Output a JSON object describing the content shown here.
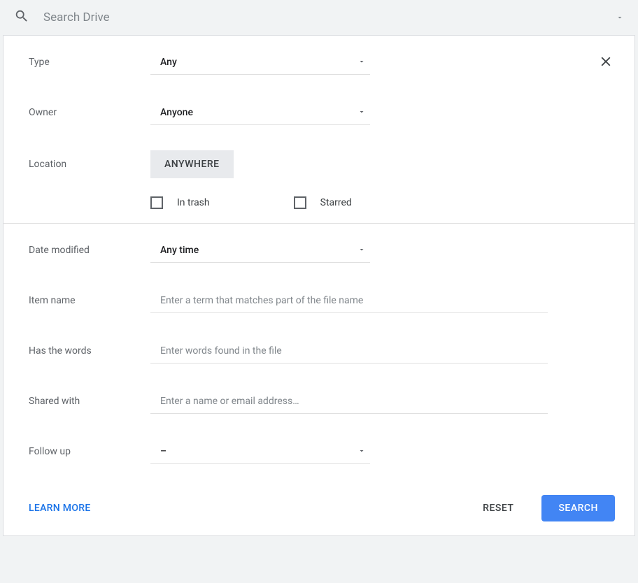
{
  "search": {
    "placeholder": "Search Drive"
  },
  "filters": {
    "type": {
      "label": "Type",
      "value": "Any"
    },
    "owner": {
      "label": "Owner",
      "value": "Anyone"
    },
    "location": {
      "label": "Location",
      "value": "ANYWHERE"
    },
    "in_trash": {
      "label": "In trash"
    },
    "starred": {
      "label": "Starred"
    },
    "date_modified": {
      "label": "Date modified",
      "value": "Any time"
    },
    "item_name": {
      "label": "Item name",
      "placeholder": "Enter a term that matches part of the file name"
    },
    "has_words": {
      "label": "Has the words",
      "placeholder": "Enter words found in the file"
    },
    "shared_with": {
      "label": "Shared with",
      "placeholder": "Enter a name or email address…"
    },
    "follow_up": {
      "label": "Follow up",
      "value": "–"
    }
  },
  "footer": {
    "learn_more": "LEARN MORE",
    "reset": "RESET",
    "search": "SEARCH"
  }
}
